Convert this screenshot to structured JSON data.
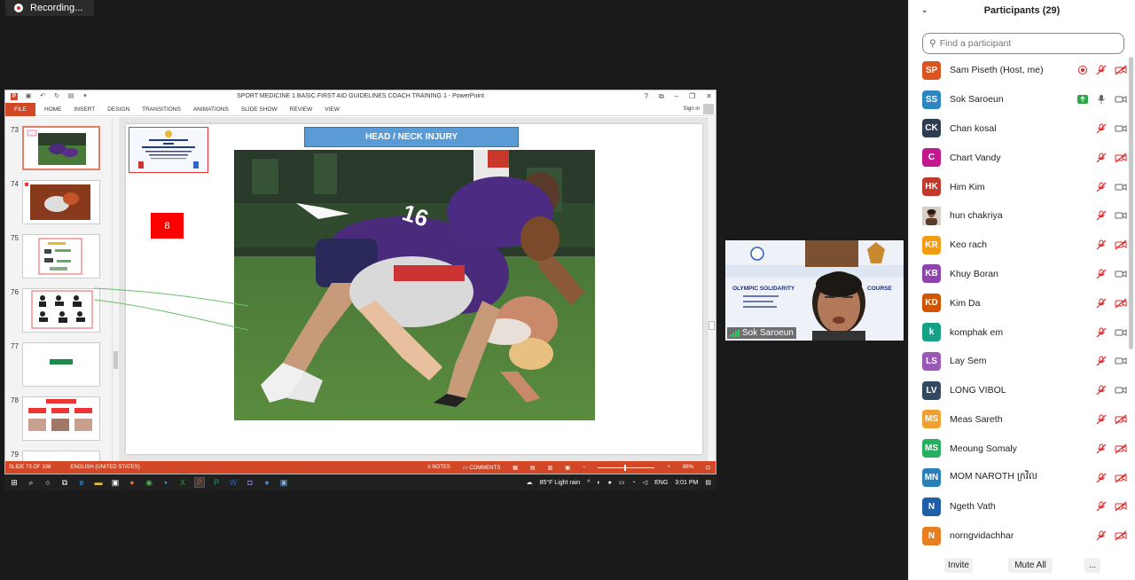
{
  "recording": {
    "label": "Recording..."
  },
  "powerpoint": {
    "window_title": "SPORT MEDICINE 1 BASIC FIRST AID GUIDELINES COACH TRAINING 1 - PowerPoint",
    "title_buttons": [
      "?",
      "⧉",
      "–",
      "❐",
      "✕"
    ],
    "tabs": [
      "FILE",
      "HOME",
      "INSERT",
      "DESIGN",
      "TRANSITIONS",
      "ANIMATIONS",
      "SLIDE SHOW",
      "REVIEW",
      "VIEW"
    ],
    "sign_in": "Sign in",
    "thumbnails": [
      {
        "num": "73"
      },
      {
        "num": "74"
      },
      {
        "num": "75"
      },
      {
        "num": "76"
      },
      {
        "num": "77"
      },
      {
        "num": "78"
      },
      {
        "num": "79"
      }
    ],
    "slide": {
      "title": "HEAD / NECK INJURY",
      "badge": "8"
    },
    "status": {
      "slide_of": "SLIDE 73 OF 106",
      "language": "ENGLISH (UNITED STATES)",
      "notes": "NOTES",
      "comments": "COMMENTS",
      "zoom": "88%"
    }
  },
  "taskbar": {
    "weather": "85°F  Light rain",
    "lang": "ENG",
    "time": "3:01 PM"
  },
  "video": {
    "name": "Sok Saroeun",
    "banner_text": "OLYMPIC SOLIDARITY",
    "banner_suffix": "COURSE"
  },
  "participants": {
    "title": "Participants (29)",
    "search_placeholder": "Find a participant",
    "list": [
      {
        "initials": "SP",
        "name": "Sam Piseth (Host, me)",
        "color": "#d9541e",
        "mic": "muted",
        "video": "off",
        "extra": "record"
      },
      {
        "initials": "SS",
        "name": "Sok Saroeun",
        "color": "#2e86c1",
        "mic": "on",
        "video": "on",
        "extra": "share"
      },
      {
        "initials": "CK",
        "name": "Chan kosal",
        "color": "#2c3e50",
        "mic": "muted",
        "video": "on"
      },
      {
        "initials": "C",
        "name": "Chart Vandy",
        "color": "#c2188f",
        "mic": "muted",
        "video": "off"
      },
      {
        "initials": "HK",
        "name": "Him Kim",
        "color": "#c0392b",
        "mic": "muted",
        "video": "on"
      },
      {
        "initials": "",
        "name": "hun chakriya",
        "color": "#7a5a4a",
        "mic": "muted",
        "video": "on",
        "photo": true
      },
      {
        "initials": "KR",
        "name": "Keo rach",
        "color": "#f39c12",
        "mic": "muted",
        "video": "off"
      },
      {
        "initials": "KB",
        "name": "Khuy Boran",
        "color": "#8e44ad",
        "mic": "muted",
        "video": "on"
      },
      {
        "initials": "KD",
        "name": "Kim Da",
        "color": "#d35400",
        "mic": "muted",
        "video": "off"
      },
      {
        "initials": "k",
        "name": "komphak em",
        "color": "#16a085",
        "mic": "muted",
        "video": "on"
      },
      {
        "initials": "LS",
        "name": "Lay Sem",
        "color": "#9b59b6",
        "mic": "muted",
        "video": "on"
      },
      {
        "initials": "LV",
        "name": "LONG VIBOL",
        "color": "#34495e",
        "mic": "muted",
        "video": "on"
      },
      {
        "initials": "MS",
        "name": "Meas Sareth",
        "color": "#f0a030",
        "mic": "muted",
        "video": "off"
      },
      {
        "initials": "MS",
        "name": "Meoung Somaly",
        "color": "#27ae60",
        "mic": "muted",
        "video": "off"
      },
      {
        "initials": "MN",
        "name": "MOM NAROTH ក្រវិល",
        "color": "#2980b9",
        "mic": "muted",
        "video": "off"
      },
      {
        "initials": "N",
        "name": "Ngeth Vath",
        "color": "#1f5fa8",
        "mic": "muted",
        "video": "off"
      },
      {
        "initials": "N",
        "name": "norngvidachhar",
        "color": "#e67e22",
        "mic": "muted",
        "video": "off"
      }
    ],
    "footer": {
      "invite": "Invite",
      "mute_all": "Mute All",
      "more": "..."
    }
  }
}
